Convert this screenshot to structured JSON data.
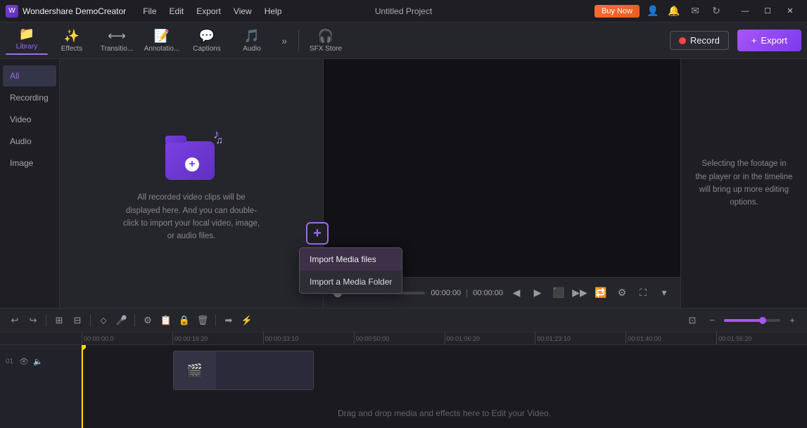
{
  "app": {
    "name": "Wondershare DemoCreator",
    "title": "Untitled Project"
  },
  "titlebar": {
    "logo_text": "Wondershare DemoCreator",
    "menus": [
      "File",
      "Edit",
      "Export",
      "View",
      "Help"
    ],
    "buy_now": "Buy Now",
    "win_controls": [
      "—",
      "☐",
      "✕"
    ]
  },
  "toolbar": {
    "items": [
      {
        "id": "library",
        "icon": "📁",
        "label": "Library",
        "active": true
      },
      {
        "id": "effects",
        "icon": "✨",
        "label": "Effects",
        "active": false
      },
      {
        "id": "transitions",
        "icon": "⟷",
        "label": "Transitio...",
        "active": false
      },
      {
        "id": "annotations",
        "icon": "📝",
        "label": "Annotatio...",
        "active": false
      },
      {
        "id": "captions",
        "icon": "💬",
        "label": "Captions",
        "active": false
      },
      {
        "id": "audio",
        "icon": "🎵",
        "label": "Audio",
        "active": false
      }
    ],
    "more_label": "»",
    "sfx_store": "SFX Store",
    "record_label": "Record",
    "export_label": "+ Export"
  },
  "sidebar": {
    "categories": [
      {
        "id": "all",
        "label": "All",
        "active": true
      },
      {
        "id": "recording",
        "label": "Recording",
        "active": false
      },
      {
        "id": "video",
        "label": "Video",
        "active": false
      },
      {
        "id": "audio",
        "label": "Audio",
        "active": false
      },
      {
        "id": "image",
        "label": "Image",
        "active": false
      }
    ],
    "empty_description": "All recorded video clips will be displayed here. And you can double-click to import your local video, image, or audio files."
  },
  "import_menu": {
    "plus_icon": "+",
    "items": [
      {
        "id": "import-files",
        "label": "Import Media files",
        "highlighted": true
      },
      {
        "id": "import-folder",
        "label": "Import a Media Folder",
        "highlighted": false
      }
    ]
  },
  "preview": {
    "time_current": "00:00:00",
    "time_separator": "|",
    "time_total": "00:00:00",
    "controls": [
      "◀",
      "▶",
      "⬛",
      "▶▶"
    ]
  },
  "right_panel": {
    "text": "Selecting the footage in the player or in the timeline will bring up more editing options."
  },
  "timeline": {
    "toolbar_buttons": [
      "↩",
      "↪",
      "⊞",
      "⊟",
      "⬦",
      "🎤",
      "⚙",
      "📋",
      "🔒",
      "🗑",
      "➡",
      "⚡"
    ],
    "ruler_marks": [
      "00:00:00.0",
      "00:00:16:20",
      "00:00:33:10",
      "00:00:50:00",
      "00:01:06:20",
      "00:01:23:10",
      "00:01:40:00",
      "00:01:56:20"
    ],
    "drag_drop_hint": "Drag and drop media and effects here to Edit your Video.",
    "track_num": "01"
  }
}
